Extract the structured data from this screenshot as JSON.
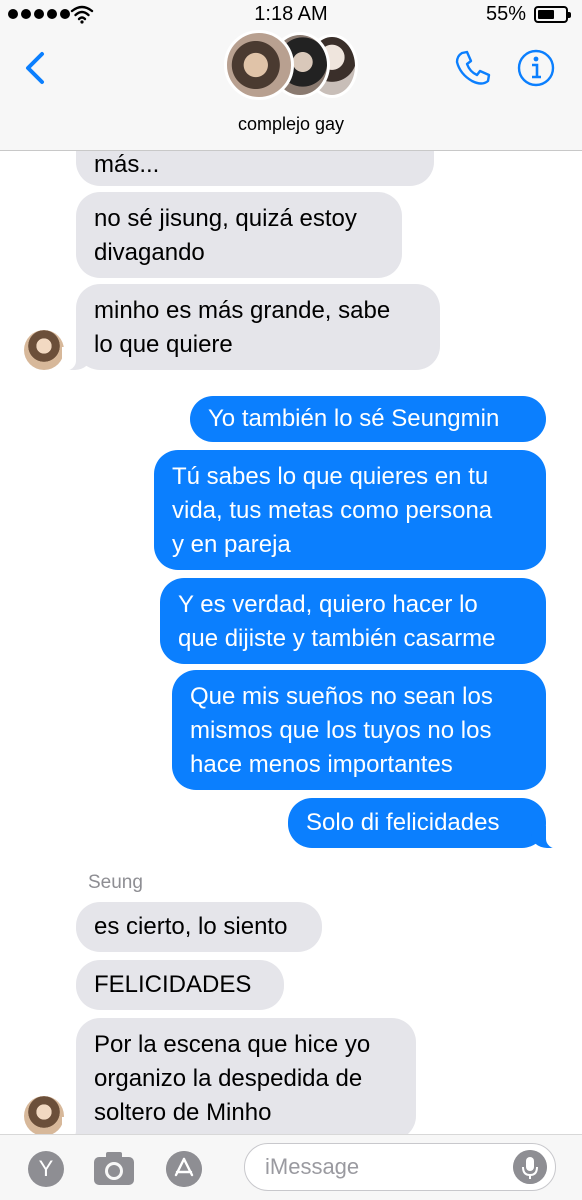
{
  "status_bar": {
    "time": "1:18 AM",
    "battery": "55%"
  },
  "header": {
    "group_name": "complejo gay"
  },
  "messages": [
    {
      "lines": [
        "más..."
      ]
    },
    {
      "lines": [
        "no sé jisung, quizá estoy",
        "divagando"
      ]
    },
    {
      "lines": [
        "minho es más grande, sabe",
        "lo que quiere"
      ]
    },
    {
      "lines": [
        "Yo también lo sé Seungmin"
      ]
    },
    {
      "lines": [
        "Tú sabes lo que quieres en tu",
        "vida, tus metas como persona",
        "y en pareja"
      ]
    },
    {
      "lines": [
        "Y es verdad, quiero hacer lo",
        "que dijiste y también casarme"
      ]
    },
    {
      "lines": [
        "Que mis sueños no sean los",
        "mismos que los tuyos no los",
        "hace menos importantes"
      ]
    },
    {
      "lines": [
        "Solo di felicidades"
      ]
    },
    {
      "lines": [
        "es cierto, lo siento"
      ]
    },
    {
      "lines": [
        "FELICIDADES"
      ]
    },
    {
      "lines": [
        "Por la escena que hice yo",
        "organizo la despedida de",
        "soltero de Minho"
      ]
    }
  ],
  "sender_label": "Seung",
  "input": {
    "placeholder": "iMessage",
    "apps_glyph": "Y"
  },
  "icons": [
    "back-chevron-icon",
    "phone-icon",
    "info-icon",
    "apps-icon",
    "camera-icon",
    "app-store-icon",
    "microphone-icon",
    "wifi-icon",
    "battery-icon"
  ],
  "colors": {
    "accent": "#0b7ffe",
    "incoming_bubble": "#e5e5ea",
    "header_bg": "#f7f7f7"
  }
}
